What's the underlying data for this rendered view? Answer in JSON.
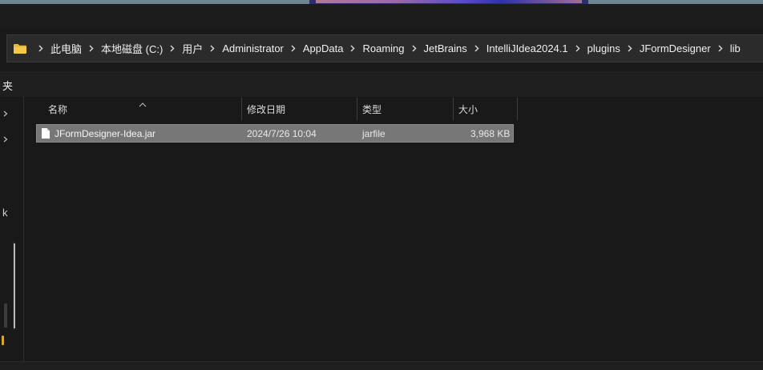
{
  "breadcrumb": {
    "items": [
      "此电脑",
      "本地磁盘 (C:)",
      "用户",
      "Administrator",
      "AppData",
      "Roaming",
      "JetBrains",
      "IntelliJIdea2024.1",
      "plugins",
      "JFormDesigner",
      "lib"
    ]
  },
  "nav": {
    "partial_label_top": "夹",
    "partial_label_mid": "k"
  },
  "columns": {
    "name": "名称",
    "modified": "修改日期",
    "type": "类型",
    "size": "大小"
  },
  "files": [
    {
      "name": "JFormDesigner-Idea.jar",
      "modified": "2024/7/26 10:04",
      "type": "jarfile",
      "size": "3,968 KB",
      "selected": true
    }
  ],
  "icons": {
    "address_folder": "folder-icon",
    "breadcrumb_separator": "chevron-right-icon",
    "file": "file-icon",
    "sort": "sort-ascending-icon",
    "nav_expand": "chevron-right-icon"
  },
  "colors": {
    "folder": "#e8b73a",
    "selection": "#777777",
    "background": "#191919"
  }
}
